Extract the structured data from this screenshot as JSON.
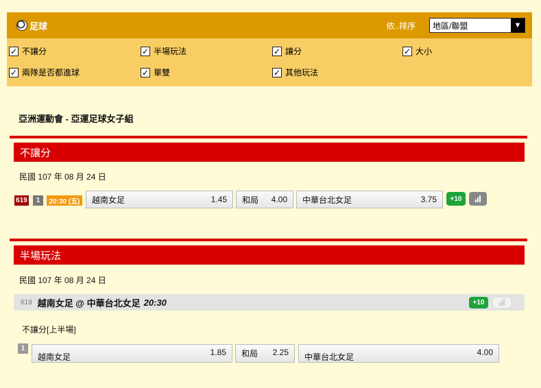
{
  "header": {
    "title": "足球",
    "sort_label": "依..排序",
    "sort_value": "地區/聯盟"
  },
  "options": [
    "不讓分",
    "半場玩法",
    "讓分",
    "大小",
    "兩隊是否都進球",
    "單雙",
    "其他玩法"
  ],
  "league": "亞洲運動會 - 亞運足球女子組",
  "section1": {
    "title": "不讓分",
    "date": "民國 107 年 08 月 24 日",
    "match": {
      "id": "619",
      "period": "1",
      "time": "20:30 (五)",
      "home": "越南女足",
      "home_odds": "1.45",
      "draw": "和局",
      "draw_odds": "4.00",
      "away": "中華台北女足",
      "away_odds": "3.75",
      "more": "+10"
    }
  },
  "section2": {
    "title": "半場玩法",
    "date": "民國 107 年 08 月 24 日",
    "match_id": "619",
    "match_title": "越南女足 @ 中華台北女足",
    "match_time": "20:30",
    "more": "+10",
    "market": "不讓分[上半場]",
    "period": "1",
    "home": "越南女足",
    "home_odds": "1.85",
    "draw": "和局",
    "draw_odds": "2.25",
    "away": "中華台北女足",
    "away_odds": "4.00"
  }
}
